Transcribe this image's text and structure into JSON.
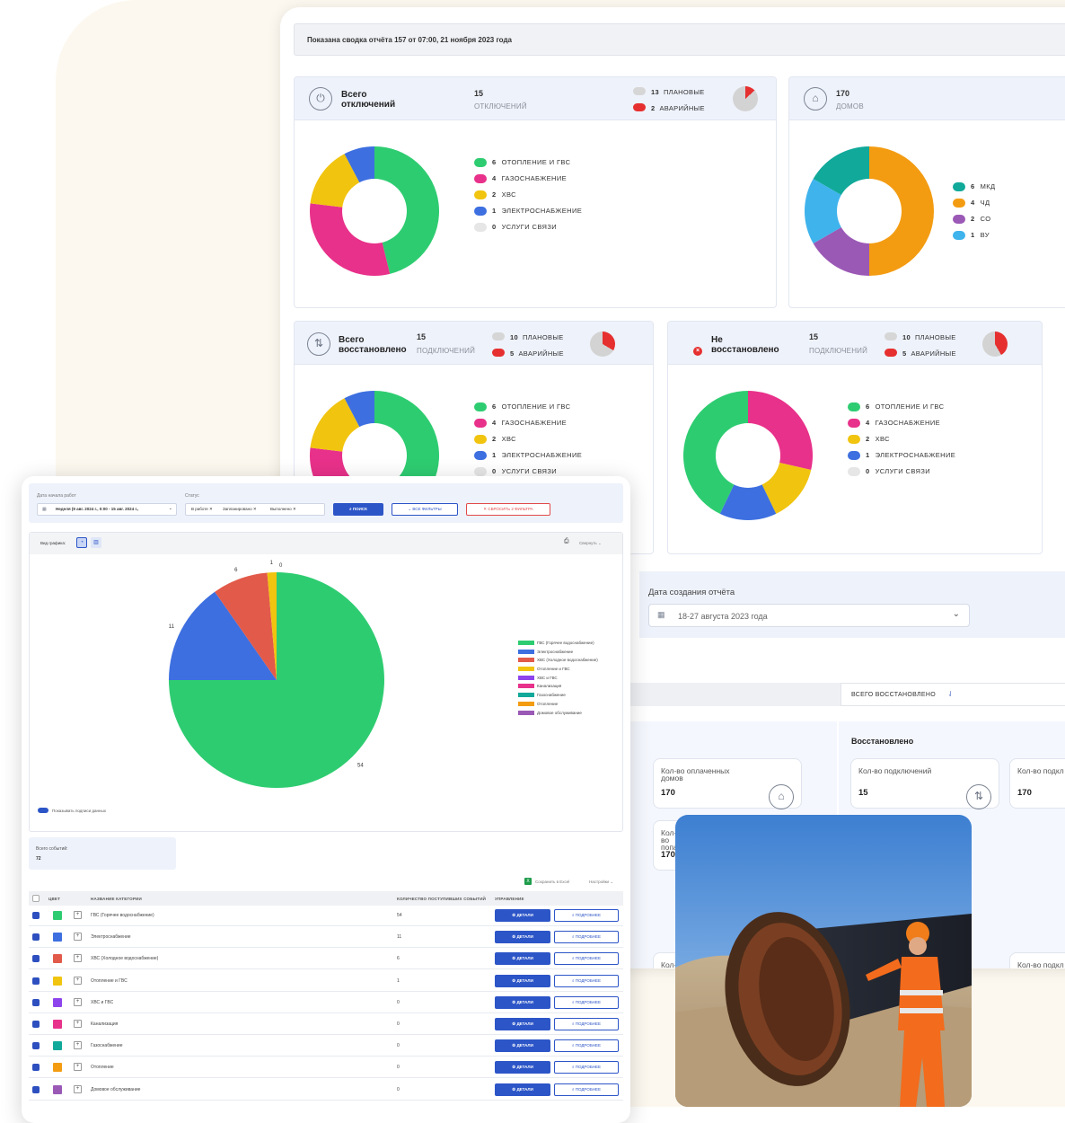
{
  "banner": "Показана сводка отчёта 157 от 07:00, 21 ноября 2023 года",
  "card1": {
    "title": "Всего отключений",
    "count": "15",
    "count_label": "ОТКЛЮЧЕНИЙ",
    "planned": {
      "value": "13",
      "label": "ПЛАНОВЫЕ"
    },
    "emergency": {
      "value": "2",
      "label": "АВАРИЙНЫЕ"
    },
    "legend": [
      {
        "value": "6",
        "label": "ОТОПЛЕНИЕ И ГВС",
        "color": "#2ecc71"
      },
      {
        "value": "4",
        "label": "ГАЗОСНАБЖЕНИЕ",
        "color": "#e8318a"
      },
      {
        "value": "2",
        "label": "ХВС",
        "color": "#f1c40f"
      },
      {
        "value": "1",
        "label": "ЭЛЕКТРОСНАБЖЕНИЕ",
        "color": "#3d6fe0"
      },
      {
        "value": "0",
        "label": "УСЛУГИ СВЯЗИ",
        "color": "#e6e6e6"
      }
    ]
  },
  "card2": {
    "count": "170",
    "count_label": "ДОМОВ",
    "legend": [
      {
        "value": "6",
        "label": "МКД",
        "color": "#10a99a"
      },
      {
        "value": "4",
        "label": "ЧД",
        "color": "#f39c12"
      },
      {
        "value": "2",
        "label": "СО",
        "color": "#9b59b6"
      },
      {
        "value": "1",
        "label": "ВУ",
        "color": "#3fb3ec"
      }
    ]
  },
  "card3": {
    "title": "Всего восстановлено",
    "count": "15",
    "count_label": "ПОДКЛЮЧЕНИЙ",
    "planned": {
      "value": "10",
      "label": "ПЛАНОВЫЕ"
    },
    "emergency": {
      "value": "5",
      "label": "АВАРИЙНЫЕ"
    },
    "legend": [
      {
        "value": "6",
        "label": "ОТОПЛЕНИЕ И ГВС",
        "color": "#2ecc71"
      },
      {
        "value": "4",
        "label": "ГАЗОСНАБЖЕНИЕ",
        "color": "#e8318a"
      },
      {
        "value": "2",
        "label": "ХВС",
        "color": "#f1c40f"
      },
      {
        "value": "1",
        "label": "ЭЛЕКТРОСНАБЖЕНИЕ",
        "color": "#3d6fe0"
      },
      {
        "value": "0",
        "label": "УСЛУГИ СВЯЗИ",
        "color": "#e6e6e6"
      }
    ]
  },
  "card4": {
    "title": "Не восстановлено",
    "count": "15",
    "count_label": "ПОДКЛЮЧЕНИЙ",
    "planned": {
      "value": "10",
      "label": "ПЛАНОВЫЕ"
    },
    "emergency": {
      "value": "5",
      "label": "АВАРИЙНЫЕ"
    },
    "legend": [
      {
        "value": "6",
        "label": "ОТОПЛЕНИЕ И ГВС",
        "color": "#2ecc71"
      },
      {
        "value": "4",
        "label": "ГАЗОСНАБЖЕНИЕ",
        "color": "#e8318a"
      },
      {
        "value": "2",
        "label": "ХВС",
        "color": "#f1c40f"
      },
      {
        "value": "1",
        "label": "ЭЛЕКТРОСНАБЖЕНИЕ",
        "color": "#3d6fe0"
      },
      {
        "value": "0",
        "label": "УСЛУГИ СВЯЗИ",
        "color": "#e6e6e6"
      }
    ]
  },
  "report_date": {
    "label": "Дата создания отчёта",
    "value": "18-27 августа 2023 года"
  },
  "restored_tab": "ВСЕГО ВОССТАНОВЛЕНО",
  "restored_section": {
    "title": "Восстановлено",
    "cards": [
      {
        "label": "Кол-во оплаченных домов",
        "value": "170"
      },
      {
        "label": "Кол-во подключений",
        "value": "15"
      },
      {
        "label": "Кол-во подкл объектов",
        "value": "170"
      },
      {
        "label": "Кол-во попа",
        "value": "170"
      }
    ],
    "bottom_labels": [
      "Кол-",
      "Кол-во подкл"
    ]
  },
  "front": {
    "filters": {
      "date_label": "Дата начала работ",
      "date_value": "Неделя (9 авг. 2024 г., 0:00 - 15 авг. 2024 г.,",
      "status_label": "Статус",
      "status_tags": [
        "В работе",
        "Запланировано",
        "Выполнено"
      ],
      "search_btn": "ПОИСК",
      "all_filters_btn": "ВСЕ ФИЛЬТРЫ",
      "reset_btn": "СБРОСИТЬ 2 ФИЛЬТРА"
    },
    "chart_header": {
      "view_label": "Вид графика:",
      "collapse": "Свернуть"
    },
    "show_labels": "Показывать подписи данных",
    "total_label": "Всего событий:",
    "total_value": "72",
    "excel": "Сохранить в Excel",
    "settings": "Настройки",
    "table_headers": [
      "ЦВЕТ",
      "НАЗВАНИЕ КАТЕГОРИИ",
      "КОЛИЧЕСТВО ПОСТУПИВШИХ СОБЫТИЙ",
      "УПРАВЛЕНИЕ"
    ],
    "details_btn": "ДЕТАЛИ",
    "more_btn": "ПОДРОБНЕЕ",
    "rows": [
      {
        "name": "ГВС (Горячее водоснабжение)",
        "count": "54",
        "color": "#2ecc71"
      },
      {
        "name": "Электроснабжение",
        "count": "11",
        "color": "#3d6fe0"
      },
      {
        "name": "ХВС (Холодное водоснабжение)",
        "count": "6",
        "color": "#e25a4a"
      },
      {
        "name": "Отопление и ГВС",
        "count": "1",
        "color": "#f1c40f"
      },
      {
        "name": "ХВС и ГВС",
        "count": "0",
        "color": "#8e44ec"
      },
      {
        "name": "Канализация",
        "count": "0",
        "color": "#e8318a"
      },
      {
        "name": "Газоснабжение",
        "count": "0",
        "color": "#10a99a"
      },
      {
        "name": "Отопление",
        "count": "0",
        "color": "#f39c12"
      },
      {
        "name": "Домовое обслуживание",
        "count": "0",
        "color": "#9b59b6"
      }
    ]
  },
  "chart_data": {
    "type": "pie",
    "categories": [
      "ГВС (Горячее водоснабжение)",
      "Электроснабжение",
      "ХВС (Холодное водоснабжение)",
      "Отопление и ГВС",
      "ХВС и ГВС",
      "Канализация",
      "Газоснабжение",
      "Отопление",
      "Домовое обслуживание"
    ],
    "values": [
      54,
      11,
      6,
      1,
      0,
      0,
      0,
      0,
      0
    ],
    "data_labels": [
      "54",
      "11",
      "6",
      "1",
      "0"
    ],
    "colors": [
      "#2ecc71",
      "#3d6fe0",
      "#e25a4a",
      "#f1c40f",
      "#8e44ec",
      "#e8318a",
      "#10a99a",
      "#f39c12",
      "#9b59b6"
    ],
    "legend_placement": "right"
  }
}
